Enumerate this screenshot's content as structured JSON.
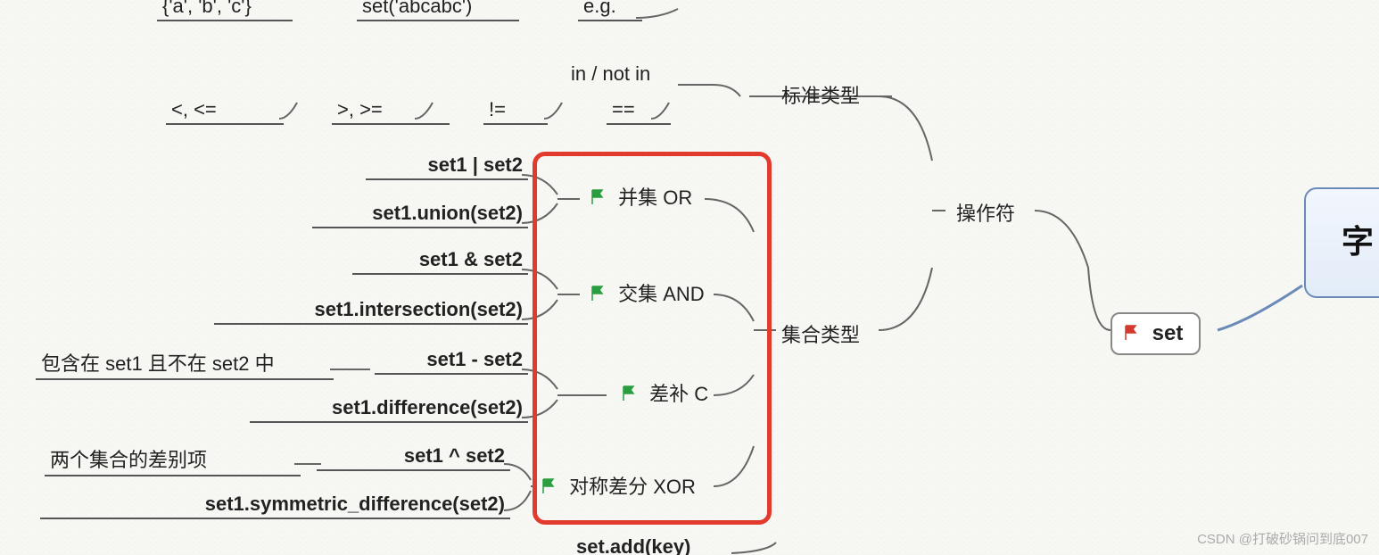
{
  "top": {
    "literal": "{'a', 'b', 'c'}",
    "ctor": "set('abcabc')",
    "eg": "e.g."
  },
  "std": {
    "in_notin": "in / not in",
    "lt": "<, <=",
    "gt": ">, >=",
    "ne": "!=",
    "eq": "==",
    "label": "标准类型"
  },
  "ops": {
    "union_op": "set1 | set2",
    "union_fn": "set1.union(set2)",
    "union_label": "并集 OR",
    "inter_op": "set1 & set2",
    "inter_fn": "set1.intersection(set2)",
    "inter_label": "交集 AND",
    "diff_desc": "包含在 set1 且不在 set2 中",
    "diff_op": "set1 - set2",
    "diff_fn": "set1.difference(set2)",
    "diff_label": "差补 C",
    "sym_desc": "两个集合的差别项",
    "sym_op": "set1 ^ set2",
    "sym_fn": "set1.symmetric_difference(set2)",
    "sym_label": "对称差分 XOR",
    "set_type_label": "集合类型",
    "operators_label": "操作符"
  },
  "bottom": {
    "add": "set.add(key)"
  },
  "root": {
    "set": "set",
    "char": "字"
  },
  "watermark": "CSDN @打破砂锅问到底007"
}
